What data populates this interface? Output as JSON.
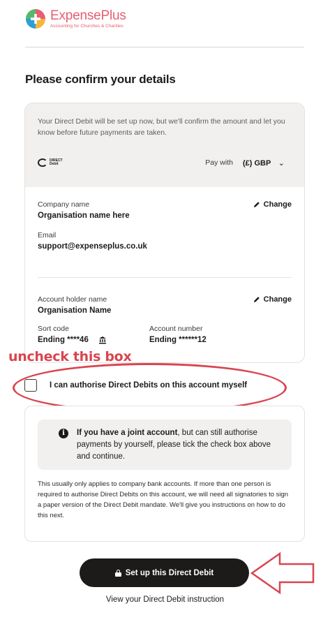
{
  "brand": {
    "name": "ExpensePlus",
    "tagline": "Accounting for Churches & Charities"
  },
  "page": {
    "title": "Please confirm your details"
  },
  "summary": {
    "info_text": "Your Direct Debit will be set up now, but we'll confirm the amount and let you know before future payments are taken.",
    "dd_logo_text_1": "DIRECT",
    "dd_logo_text_2": "Debit",
    "pay_with_label": "Pay with",
    "currency": "(£) GBP"
  },
  "company": {
    "name_label": "Company name",
    "name_value": "Organisation name here",
    "email_label": "Email",
    "email_value": "support@expenseplus.co.uk",
    "change_label": "Change"
  },
  "account": {
    "holder_label": "Account holder name",
    "holder_value": "Organisation Name",
    "sort_code_label": "Sort code",
    "sort_code_value": "Ending ****46",
    "account_number_label": "Account number",
    "account_number_value": "Ending ******12",
    "change_label": "Change"
  },
  "annotation": {
    "text": "uncheck this box",
    "color": "#d94550"
  },
  "authorise_checkbox": {
    "label": "I can authorise Direct Debits on this account myself",
    "checked": false
  },
  "notice": {
    "bold": "If you have a joint account",
    "rest": ", but can still authorise payments by yourself, please tick the check box above and continue.",
    "small_text": "This usually only applies to company bank accounts. If more than one person is required to authorise Direct Debits on this account, we will need all signatories to sign a paper version of the Direct Debit mandate. We'll give you instructions on how to do this next."
  },
  "actions": {
    "primary_button": "Set up this Direct Debit",
    "link": "View your Direct Debit instruction"
  },
  "colors": {
    "brand": "#e85d6f",
    "button_bg": "#1c1b1a",
    "panel_bg": "#f1f0ee"
  }
}
